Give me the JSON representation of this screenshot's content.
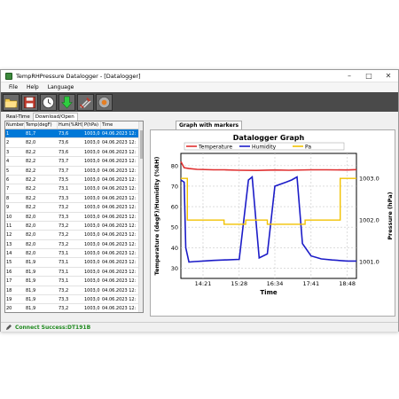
{
  "window": {
    "title": "TempRHPressure Datalogger - [Datalogger]"
  },
  "menu": [
    "File",
    "Help",
    "Language"
  ],
  "toolbar": [
    "open-folder-icon",
    "save-disk-icon",
    "clock-icon",
    "download-arrow-icon",
    "settings-tools-icon",
    "erase-logger-icon"
  ],
  "tabs": [
    "Real-Time",
    "Download/Open"
  ],
  "table": {
    "columns": [
      "Number",
      "Temp(degF)",
      "Hum(%RH)",
      "P(hPa)",
      "Time"
    ],
    "rows": [
      [
        "1",
        "81,7",
        "73,6",
        "1003,0",
        "04.06.2023 12:"
      ],
      [
        "2",
        "82,0",
        "73,6",
        "1003,0",
        "04.06.2023 12:"
      ],
      [
        "3",
        "82,2",
        "73,6",
        "1003,0",
        "04.06.2023 12:"
      ],
      [
        "4",
        "82,2",
        "73,7",
        "1003,0",
        "04.06.2023 12:"
      ],
      [
        "5",
        "82,2",
        "73,7",
        "1003,0",
        "04.06.2023 12:"
      ],
      [
        "6",
        "82,2",
        "73,5",
        "1003,0",
        "04.06.2023 12:"
      ],
      [
        "7",
        "82,2",
        "73,1",
        "1003,0",
        "04.06.2023 12:"
      ],
      [
        "8",
        "82,2",
        "73,3",
        "1003,0",
        "04.06.2023 12:"
      ],
      [
        "9",
        "82,2",
        "73,2",
        "1003,0",
        "04.06.2023 12:"
      ],
      [
        "10",
        "82,0",
        "73,3",
        "1003,0",
        "04.06.2023 12:"
      ],
      [
        "11",
        "82,0",
        "73,2",
        "1003,0",
        "04.06.2023 12:"
      ],
      [
        "12",
        "82,0",
        "73,2",
        "1003,0",
        "04.06.2023 12:"
      ],
      [
        "13",
        "82,0",
        "73,2",
        "1003,0",
        "04.06.2023 12:"
      ],
      [
        "14",
        "82,0",
        "73,1",
        "1003,0",
        "04.06.2023 12:"
      ],
      [
        "15",
        "81,9",
        "73,1",
        "1003,0",
        "04.06.2023 12:"
      ],
      [
        "16",
        "81,9",
        "73,1",
        "1003,0",
        "04.06.2023 12:"
      ],
      [
        "17",
        "81,9",
        "73,1",
        "1003,0",
        "04.06.2023 12:"
      ],
      [
        "18",
        "81,9",
        "73,2",
        "1003,0",
        "04.06.2023 12:"
      ],
      [
        "19",
        "81,9",
        "73,3",
        "1003,0",
        "04.06.2023 12:"
      ],
      [
        "20",
        "81,9",
        "73,2",
        "1003,0",
        "04.06.2023 12:"
      ]
    ],
    "selected_row": 0
  },
  "graph_tab": "Graph with markers",
  "chart_data": {
    "type": "line",
    "title": "Datalogger Graph",
    "xlabel": "Time",
    "ylabel": "Temperature (degF)/Humidity (%RH)",
    "ylabel_right": "Pressure (hPa)",
    "x_ticks": [
      "14:21",
      "15:28",
      "16:34",
      "17:41",
      "18:48"
    ],
    "y_ticks": [
      "80",
      "70",
      "60",
      "50",
      "40",
      "30"
    ],
    "y_right_ticks": [
      "1003.0",
      "1002.0",
      "1001.0"
    ],
    "ylim": [
      25,
      86
    ],
    "ylim_right": [
      1000.6,
      1003.6
    ],
    "grid": true,
    "legend": "top",
    "series": [
      {
        "name": "Temperature",
        "color": "#e03030",
        "axis": "left",
        "x": [
          "13:40",
          "13:46",
          "13:55",
          "14:10",
          "14:40",
          "15:00",
          "15:28",
          "16:00",
          "16:34",
          "17:00",
          "17:41",
          "18:10",
          "18:48",
          "19:05"
        ],
        "values": [
          82,
          79,
          78.6,
          78.2,
          78.0,
          78.0,
          77.8,
          77.7,
          77.9,
          77.8,
          78.0,
          78.0,
          77.9,
          78.1
        ]
      },
      {
        "name": "Humidity",
        "color": "#1c1cc8",
        "axis": "left",
        "x": [
          "13:40",
          "13:46",
          "13:49",
          "13:55",
          "14:05",
          "14:21",
          "14:40",
          "15:00",
          "15:28",
          "15:45",
          "15:52",
          "16:05",
          "16:20",
          "16:34",
          "16:55",
          "17:05",
          "17:15",
          "17:25",
          "17:41",
          "18:00",
          "18:20",
          "18:48",
          "19:05"
        ],
        "values": [
          73,
          72,
          40,
          33,
          33.2,
          33.5,
          33.8,
          34,
          34.3,
          73,
          74.5,
          35,
          37,
          70,
          72,
          73,
          74.5,
          42,
          36,
          34.5,
          34,
          33.5,
          33.5
        ]
      },
      {
        "name": "Pa",
        "color": "#f2c200",
        "axis": "right",
        "x": [
          "13:40",
          "13:52",
          "13:52",
          "15:00",
          "15:00",
          "15:40",
          "15:40",
          "16:20",
          "16:20",
          "17:30",
          "17:30",
          "18:35",
          "18:35",
          "19:05"
        ],
        "values": [
          1003.0,
          1003.0,
          1002.0,
          1002.0,
          1001.9,
          1001.9,
          1002.0,
          1002.0,
          1001.9,
          1001.9,
          1002.0,
          1002.0,
          1003.0,
          1003.0
        ]
      }
    ]
  },
  "status": {
    "text": "Connect Success:DT191B",
    "icon": "pencil-icon"
  }
}
